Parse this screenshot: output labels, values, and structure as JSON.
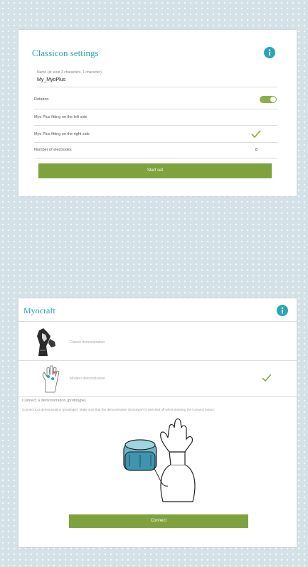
{
  "classicon": {
    "title": "Classicon settings",
    "name_field": {
      "label": "Name (at least 3 characters, 1 character)",
      "value": "My_MyoPlus"
    },
    "rows": [
      {
        "label": "Rotation",
        "control": "toggle",
        "toggle_on": true
      },
      {
        "label": "Myo Plus fitting on the left side",
        "control": "none"
      },
      {
        "label": "Myo Plus fitting on the right side",
        "control": "check"
      },
      {
        "label": "Number of electrodes",
        "control": "value",
        "value": "8"
      }
    ],
    "button": "Start set"
  },
  "myocraft": {
    "title": "Myocraft",
    "options": [
      {
        "label": "Classic demonstration",
        "selected": false
      },
      {
        "label": "Modern demonstration",
        "selected": true
      }
    ],
    "connect_title": "Connect a demonstration (prototype)",
    "connect_description": "Connect to a demonstration (prototype). Make sure that the demonstration (prototype) is switched off when pressing the Connect button.",
    "button": "Connect"
  },
  "colors": {
    "accent": "#27a6b8",
    "green": "#7ea33e",
    "background": "#d4e1e6"
  }
}
